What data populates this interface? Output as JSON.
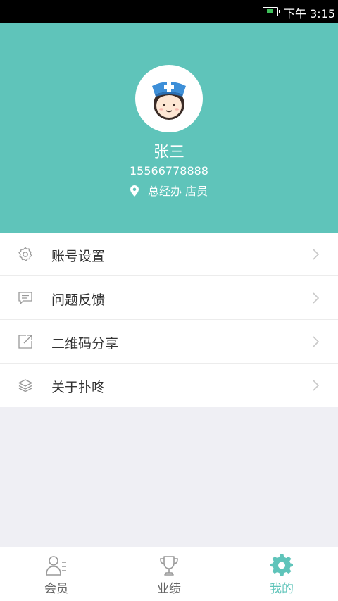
{
  "status_bar": {
    "time": "下午 3:15"
  },
  "profile": {
    "name": "张三",
    "phone": "15566778888",
    "location": "总经办 店员"
  },
  "menu": [
    {
      "label": "账号设置",
      "icon": "gear-icon"
    },
    {
      "label": "问题反馈",
      "icon": "message-icon"
    },
    {
      "label": "二维码分享",
      "icon": "share-icon"
    },
    {
      "label": "关于扑咚",
      "icon": "layers-icon"
    }
  ],
  "tabs": [
    {
      "label": "会员",
      "icon": "member-icon",
      "active": false
    },
    {
      "label": "业绩",
      "icon": "trophy-icon",
      "active": false
    },
    {
      "label": "我的",
      "icon": "gear-icon",
      "active": true
    }
  ],
  "colors": {
    "primary": "#5fc4ba",
    "text": "#333333",
    "muted": "#666666",
    "background": "#efeff4"
  }
}
